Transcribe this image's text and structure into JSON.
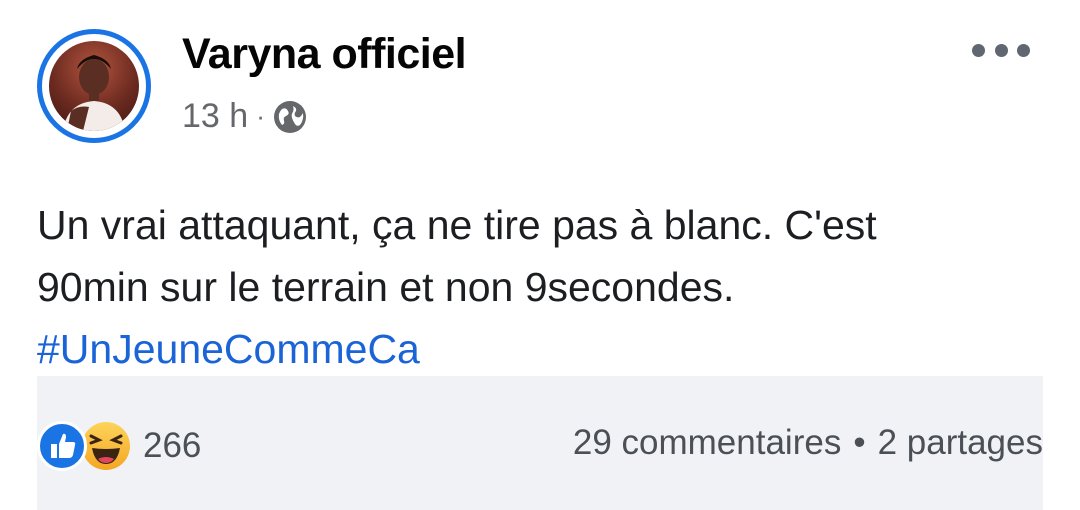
{
  "post": {
    "author": "Varyna officiel",
    "time": "13 h",
    "separator": "·",
    "audience_icon": "globe-icon",
    "more_icon": "more-horizontal-icon",
    "text_line1": "Un vrai attaquant, ça ne tire pas à blanc. C'est",
    "text_line2": "90min sur le terrain et non 9secondes.",
    "hashtag": "#UnJeuneCommeCa"
  },
  "engagement": {
    "reaction_icons": [
      "like-icon",
      "haha-icon"
    ],
    "reaction_count": "266",
    "comments": "29 commentaires",
    "separator": "•",
    "shares": "2 partages"
  },
  "colors": {
    "accent": "#1b74e4",
    "hashtag": "#1b64d8",
    "secondary_text": "#65676b",
    "footer_bg": "#f0f2f5"
  }
}
